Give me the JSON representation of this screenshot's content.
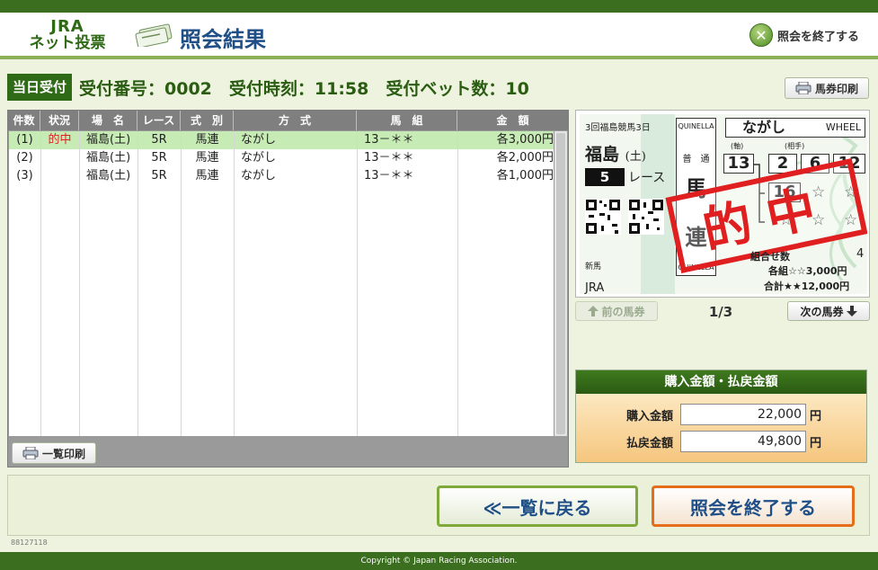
{
  "header": {
    "logo_line1": "JRA",
    "logo_line2": "ネット投票",
    "page_title": "照会結果",
    "end_inquiry": "照会を終了する",
    "close_icon": "x-circle-icon"
  },
  "info": {
    "tag": "当日受付",
    "text": "受付番号：0002　受付時刻：11:58　受付ベット数：10"
  },
  "print_ticket_label": "馬券印刷",
  "print_list_label": "一覧印刷",
  "list": {
    "columns": [
      "件数",
      "状況",
      "場　名",
      "レース",
      "式　別",
      "方　式",
      "馬　組",
      "金　額"
    ],
    "rows": [
      {
        "no": "(1)",
        "status": "的中",
        "place": "福島(土)",
        "race": "5R",
        "type": "馬連",
        "method": "ながし",
        "combo": "13－＊＊",
        "amount": "各3,000円"
      },
      {
        "no": "(2)",
        "status": "",
        "place": "福島(土)",
        "race": "5R",
        "type": "馬連",
        "method": "ながし",
        "combo": "13－＊＊",
        "amount": "各2,000円"
      },
      {
        "no": "(3)",
        "status": "",
        "place": "福島(土)",
        "race": "5R",
        "type": "馬連",
        "method": "ながし",
        "combo": "13－＊＊",
        "amount": "各1,000円"
      }
    ]
  },
  "ticket": {
    "meeting": "3回福島競馬3日",
    "place": "福島",
    "day": "(土)",
    "race_no": "5",
    "race_unit": "レース",
    "quinella_top": "QUINELLA",
    "kind": "普　通",
    "type_char1": "馬",
    "type_char2": "連",
    "quinella_bottom": "QUINELLA",
    "method": "ながし",
    "method_en": "WHEEL",
    "axis_label": "(軸)",
    "partner_label": "(相手)",
    "axis": "13",
    "partners": [
      "2",
      "6",
      "12",
      "16"
    ],
    "stars": [
      "☆",
      "☆",
      "☆",
      "☆",
      "☆"
    ],
    "hit_stamp": "的中",
    "category": "新馬",
    "issuer": "JRA",
    "combo_count_label": "組合せ数",
    "combo_count": "4",
    "each_line": "各組☆☆3,000円",
    "total_line": "合計★★12,000円"
  },
  "pager": {
    "prev": "前の馬券",
    "next": "次の馬券",
    "count": "1/3"
  },
  "amounts": {
    "title": "購入金額・払戻金額",
    "purchase_label": "購入金額",
    "purchase_value": "22,000",
    "payout_label": "払戻金額",
    "payout_value": "49,800",
    "yen": "円"
  },
  "buttons": {
    "back": "≪一覧に戻る",
    "end": "照会を終了する"
  },
  "code": "88127118",
  "footer": "Copyright © Japan Racing Association.",
  "colors": {
    "brand_green": "#3b6e1f",
    "title_blue": "#1f4f86",
    "hit_red": "#e02020",
    "end_orange": "#e46e1a"
  }
}
